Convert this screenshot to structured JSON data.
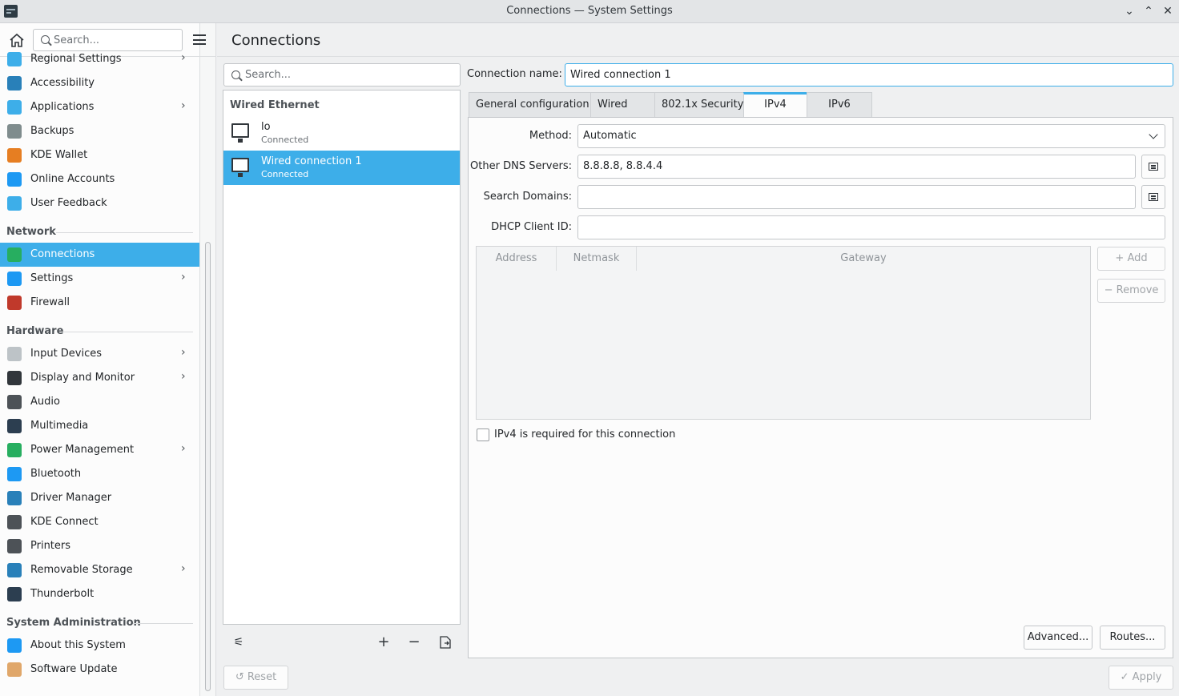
{
  "window": {
    "title": "Connections — System Settings"
  },
  "sidebar": {
    "search_placeholder": "Search...",
    "items": [
      {
        "label": "Regional Settings",
        "icon": "regional-settings-icon",
        "color": "#3daee9",
        "chevron": true
      },
      {
        "label": "Accessibility",
        "icon": "accessibility-icon",
        "color": "#2980b9"
      },
      {
        "label": "Applications",
        "icon": "applications-icon",
        "color": "#3daee9",
        "chevron": true
      },
      {
        "label": "Backups",
        "icon": "backups-icon",
        "color": "#7f8c8d"
      },
      {
        "label": "KDE Wallet",
        "icon": "kde-wallet-icon",
        "color": "#e67e22"
      },
      {
        "label": "Online Accounts",
        "icon": "online-accounts-icon",
        "color": "#1d99f3"
      },
      {
        "label": "User Feedback",
        "icon": "user-feedback-icon",
        "color": "#3daee9"
      }
    ],
    "categories": {
      "network": "Network",
      "hardware": "Hardware",
      "sysadmin": "System Administration"
    },
    "network_items": [
      {
        "label": "Connections",
        "icon": "connections-icon",
        "color": "#27ae60",
        "selected": true
      },
      {
        "label": "Settings",
        "icon": "network-settings-icon",
        "color": "#1d99f3",
        "chevron": true
      },
      {
        "label": "Firewall",
        "icon": "firewall-icon",
        "color": "#c0392b"
      }
    ],
    "hardware_items": [
      {
        "label": "Input Devices",
        "icon": "input-devices-icon",
        "color": "#bdc3c7",
        "chevron": true
      },
      {
        "label": "Display and Monitor",
        "icon": "display-monitor-icon",
        "color": "#31363b",
        "chevron": true
      },
      {
        "label": "Audio",
        "icon": "audio-icon",
        "color": "#4d5257"
      },
      {
        "label": "Multimedia",
        "icon": "multimedia-icon",
        "color": "#2c3e50"
      },
      {
        "label": "Power Management",
        "icon": "power-management-icon",
        "color": "#27ae60",
        "chevron": true
      },
      {
        "label": "Bluetooth",
        "icon": "bluetooth-icon",
        "color": "#1d99f3"
      },
      {
        "label": "Driver Manager",
        "icon": "driver-manager-icon",
        "color": "#2980b9"
      },
      {
        "label": "KDE Connect",
        "icon": "kde-connect-icon",
        "color": "#4d5257"
      },
      {
        "label": "Printers",
        "icon": "printers-icon",
        "color": "#4d5257"
      },
      {
        "label": "Removable Storage",
        "icon": "removable-storage-icon",
        "color": "#2980b9",
        "chevron": true
      },
      {
        "label": "Thunderbolt",
        "icon": "thunderbolt-icon",
        "color": "#2c3e50"
      }
    ],
    "sysadmin_items": [
      {
        "label": "About this System",
        "icon": "about-system-icon",
        "color": "#1d99f3"
      },
      {
        "label": "Software Update",
        "icon": "software-update-icon",
        "color": "#e0a76a"
      }
    ]
  },
  "header": {
    "title": "Connections"
  },
  "connections": {
    "search_placeholder": "Search...",
    "group": "Wired Ethernet",
    "items": [
      {
        "name": "lo",
        "status": "Connected"
      },
      {
        "name": "Wired connection 1",
        "status": "Connected",
        "selected": true
      }
    ]
  },
  "detail": {
    "connection_name_label": "Connection name:",
    "connection_name_value": "Wired connection 1",
    "tabs": [
      "General configuration",
      "Wired",
      "802.1x Security",
      "IPv4",
      "IPv6"
    ],
    "active_tab": "IPv4",
    "method_label": "Method:",
    "method_value": "Automatic",
    "dns_label": "Other DNS Servers:",
    "dns_value": "8.8.8.8, 8.8.4.4",
    "search_domains_label": "Search Domains:",
    "search_domains_value": "",
    "dhcp_label": "DHCP Client ID:",
    "dhcp_value": "",
    "table_headers": [
      "Address",
      "Netmask",
      "Gateway"
    ],
    "add_label": "Add",
    "remove_label": "Remove",
    "ipv4_required_label": "IPv4 is required for this connection",
    "advanced_label": "Advanced...",
    "routes_label": "Routes..."
  },
  "footer": {
    "reset_label": "Reset",
    "apply_label": "Apply"
  },
  "colors": {
    "accent": "#3daee9"
  }
}
